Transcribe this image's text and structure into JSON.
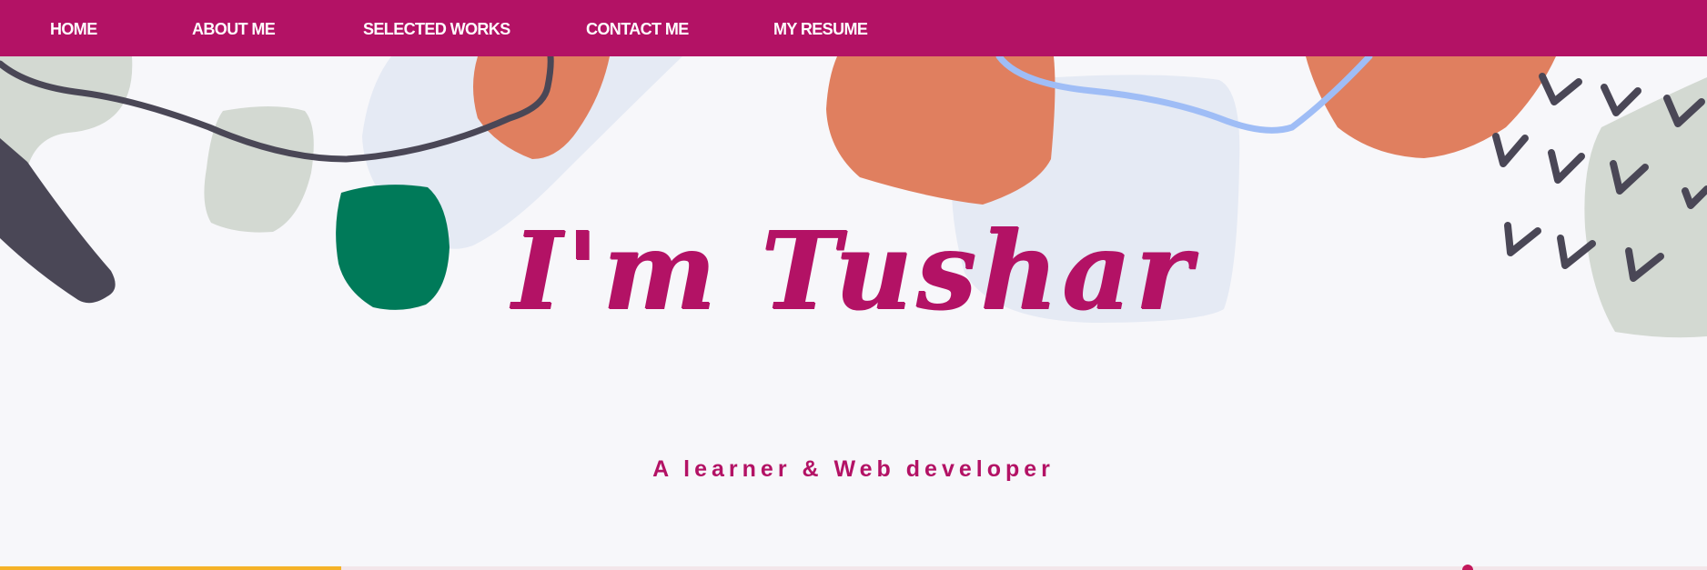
{
  "nav": {
    "home": "HOME",
    "about": "ABOUT ME",
    "works": "SELECTED WORKS",
    "contact": "CONTACT ME",
    "resume": "MY RESUME"
  },
  "hero": {
    "title": "I'm Tushar",
    "subtitle": "A learner & Web developer"
  },
  "scroll_progress": 0.2,
  "colors": {
    "brand": "#b31265",
    "background": "#f7f7fa",
    "orange_shape": "#e07f5f",
    "green_blob": "#007a59",
    "sage_shape": "#d3d9d2",
    "pale_blue_shape": "#e5eaf4",
    "blue_line": "#9fbdf6",
    "dark_shape": "#4a4756",
    "progress": "#f5b227"
  }
}
